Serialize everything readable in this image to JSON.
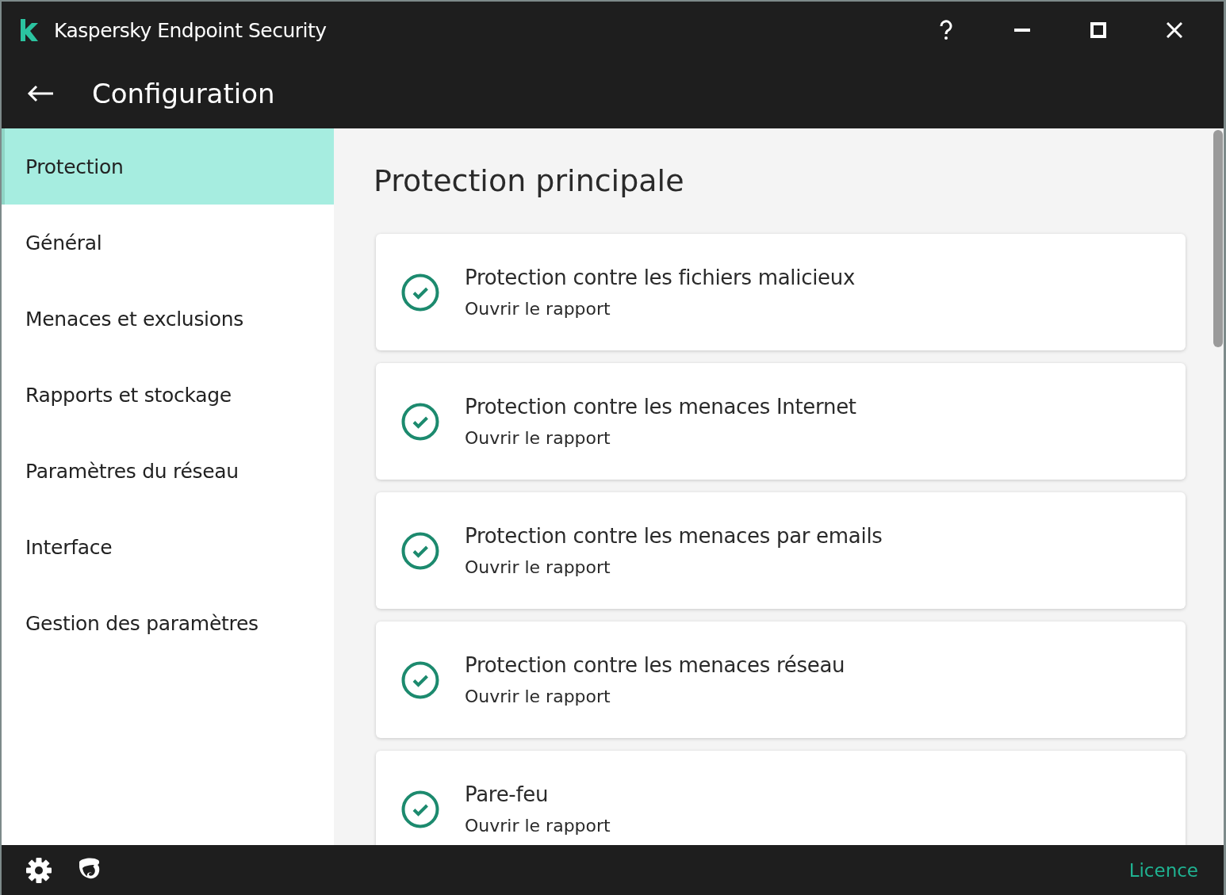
{
  "window": {
    "title": "Kaspersky Endpoint Security"
  },
  "header": {
    "title": "Configuration"
  },
  "sidebar": {
    "items": [
      {
        "label": "Protection",
        "selected": true
      },
      {
        "label": "Général",
        "selected": false
      },
      {
        "label": "Menaces et exclusions",
        "selected": false
      },
      {
        "label": "Rapports et stockage",
        "selected": false
      },
      {
        "label": "Paramètres du réseau",
        "selected": false
      },
      {
        "label": "Interface",
        "selected": false
      },
      {
        "label": "Gestion des paramètres",
        "selected": false
      }
    ]
  },
  "content": {
    "title": "Protection principale",
    "cards": [
      {
        "title": "Protection contre les fichiers malicieux",
        "link": "Ouvrir le rapport",
        "enabled": true
      },
      {
        "title": "Protection contre les menaces Internet",
        "link": "Ouvrir le rapport",
        "enabled": true
      },
      {
        "title": "Protection contre les menaces par emails",
        "link": "Ouvrir le rapport",
        "enabled": true
      },
      {
        "title": "Protection contre les menaces réseau",
        "link": "Ouvrir le rapport",
        "enabled": true
      },
      {
        "title": "Pare-feu",
        "link": "Ouvrir le rapport",
        "enabled": true
      }
    ]
  },
  "footer": {
    "link": "Licence"
  }
}
